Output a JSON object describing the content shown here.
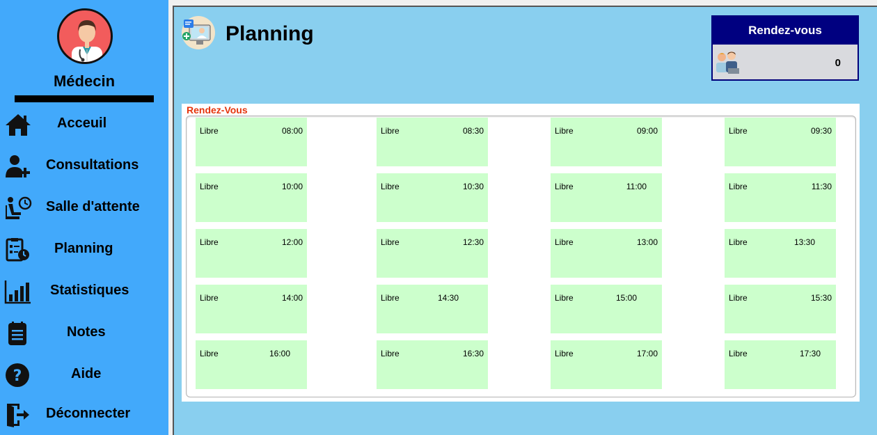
{
  "sidebar": {
    "role": "Médecin",
    "items": [
      {
        "label": "Acceuil",
        "icon": "home-icon"
      },
      {
        "label": "Consultations",
        "icon": "add-user-icon"
      },
      {
        "label": "Salle d'attente",
        "icon": "waiting-room-icon"
      },
      {
        "label": "Planning",
        "icon": "planning-icon"
      },
      {
        "label": "Statistiques",
        "icon": "bar-chart-icon"
      },
      {
        "label": "Notes",
        "icon": "notes-icon"
      },
      {
        "label": "Aide",
        "icon": "help-icon"
      },
      {
        "label": "Déconnecter",
        "icon": "logout-icon"
      }
    ]
  },
  "header": {
    "title": "Planning"
  },
  "rdv_widget": {
    "title": "Rendez-vous",
    "count": "0"
  },
  "panel": {
    "title": "Rendez-Vous",
    "slots": [
      {
        "status": "Libre",
        "time": "08:00"
      },
      {
        "status": "Libre",
        "time": "08:30"
      },
      {
        "status": "Libre",
        "time": "09:00"
      },
      {
        "status": "Libre",
        "time": "09:30"
      },
      {
        "status": "Libre",
        "time": "10:00"
      },
      {
        "status": "Libre",
        "time": "10:30"
      },
      {
        "status": "Libre",
        "time": "11:00"
      },
      {
        "status": "Libre",
        "time": "11:30"
      },
      {
        "status": "Libre",
        "time": "12:00"
      },
      {
        "status": "Libre",
        "time": "12:30"
      },
      {
        "status": "Libre",
        "time": "13:00"
      },
      {
        "status": "Libre",
        "time": "13:30"
      },
      {
        "status": "Libre",
        "time": "14:00"
      },
      {
        "status": "Libre",
        "time": "14:30"
      },
      {
        "status": "Libre",
        "time": "15:00"
      },
      {
        "status": "Libre",
        "time": "15:30"
      },
      {
        "status": "Libre",
        "time": "16:00"
      },
      {
        "status": "Libre",
        "time": "16:30"
      },
      {
        "status": "Libre",
        "time": "17:00"
      },
      {
        "status": "Libre",
        "time": "17:30"
      }
    ]
  },
  "colors": {
    "sidebar": "#42a9fb",
    "main": "#89cfef",
    "slot": "#ccffcc",
    "widget_header": "#000080",
    "panel_title": "#e5350c"
  }
}
